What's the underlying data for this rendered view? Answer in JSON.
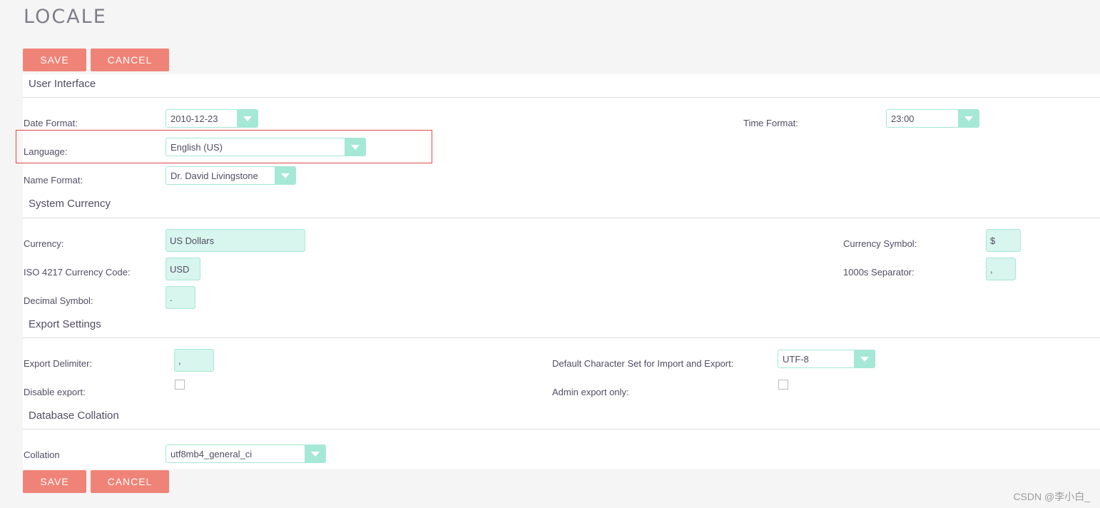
{
  "page": {
    "title": "LOCALE"
  },
  "buttons": {
    "save": "SAVE",
    "cancel": "CANCEL"
  },
  "user_interface": {
    "heading": "User Interface",
    "date_format": {
      "label": "Date Format:",
      "value": "2010-12-23"
    },
    "time_format": {
      "label": "Time Format:",
      "value": "23:00"
    },
    "language": {
      "label": "Language:",
      "value": "English (US)"
    },
    "name_format": {
      "label": "Name Format:",
      "value": "Dr. David Livingstone"
    }
  },
  "system_currency": {
    "heading": "System Currency",
    "currency": {
      "label": "Currency:",
      "value": "US Dollars"
    },
    "currency_symbol": {
      "label": "Currency Symbol:",
      "value": "$"
    },
    "iso_code": {
      "label": "ISO 4217 Currency Code:",
      "value": "USD"
    },
    "thousands_separator": {
      "label": "1000s Separator:",
      "value": ","
    },
    "decimal_symbol": {
      "label": "Decimal Symbol:",
      "value": "."
    }
  },
  "export_settings": {
    "heading": "Export Settings",
    "export_delimiter": {
      "label": "Export Delimiter:",
      "value": ","
    },
    "charset": {
      "label": "Default Character Set for Import and Export:",
      "value": "UTF-8"
    },
    "disable_export": {
      "label": "Disable export:",
      "checked": false
    },
    "admin_export_only": {
      "label": "Admin export only:",
      "checked": false
    }
  },
  "database_collation": {
    "heading": "Database Collation",
    "collation": {
      "label": "Collation",
      "value": "utf8mb4_general_ci"
    }
  },
  "watermark": "CSDN @李小白_"
}
